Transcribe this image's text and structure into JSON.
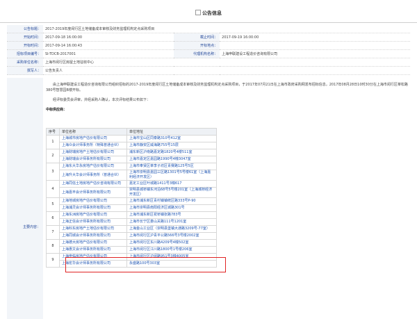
{
  "header": {
    "title": "公告信息"
  },
  "meta": {
    "rows": [
      {
        "k1": "公告标题：",
        "v1": "2017-2019年度闵行区土地储备成本审核及财务监理机构定点采购项目",
        "k2": "",
        "v2": ""
      },
      {
        "k1": "开始时间：",
        "v1": "2017-09-18 16:00:00",
        "k2": "截止时间：",
        "v2": "2017-09-19 16:00:00"
      },
      {
        "k1": "开标时间：",
        "v1": "2017-09-14 16:00:43",
        "k2": "开标地点：",
        "v2": ""
      },
      {
        "k1": "招标项目编号：",
        "v1": "SI-TDCB-2017001",
        "k2": "代理机构名称：",
        "v2": "上海申联建设工程造价咨询有限公司"
      },
      {
        "k1": "采购单位名称：",
        "v1": "上海市闵行区房屋土地征收中心",
        "k2": "",
        "v2": ""
      },
      {
        "k1": "撰写人：",
        "v1": "公告负责人",
        "k2": "",
        "v2": ""
      }
    ]
  },
  "main": {
    "label": "主要内容：",
    "para1": "由上海申联建设工程造价咨询有限公司组织招标的2017-2019年度闵行区土地储备成本审核及财务监理机构定点采购项目，于2017年07月21日在上海市政府采购网发布招标信息，2017年08月28日10时30分在上海市闵行区莘松路380号智慧园B楼开标。",
    "para2": "经评标委员会评审，并经采购人确认，本次评标结果公布如下：",
    "subtitle": "中标供应商：",
    "table": {
      "headers": [
        "序号",
        "单位名称",
        "单位地址"
      ],
      "rows": [
        {
          "n": "1",
          "unit": "上海城市房地产估价有限公司",
          "addr": "上海市宝山区同泰路310号412室"
        },
        {
          "n": "",
          "unit": "上海众会计师事务所（特殊普通合伙）",
          "addr": "上海市静安区威海路755号15层"
        },
        {
          "n": "2",
          "unit": "上海财瑞房地产土地估价有限公司",
          "addr": "浦东新区沪南路嘉定路1820号4楼511室"
        },
        {
          "n": "",
          "unit": "上海财瑞会计师事务所有限公司",
          "addr": "上海市嘉定区嘉园路1990号4幢3047室"
        },
        {
          "n": "3",
          "unit": "上海东大华永房地产估价有限公司",
          "addr": "上海市奉贤区莘李子坊区青赛路125号5区"
        },
        {
          "n": "",
          "unit": "上海升大华会计师事务所（普通合伙）",
          "addr": "上海市崇明县嘉园三区路1301号5号楼61室（上海嘉利经济开发区）"
        },
        {
          "n": "4",
          "unit": "上海同信土地房地产估价咨询有限公司",
          "addr": "嘉定工业区叶城路1411号3幢617"
        },
        {
          "n": "",
          "unit": "上海嘉丰会计师事务所有限公司",
          "addr": "崇明县城桥镇东河沿68号5号楼201室（上海城桥经济开发区）"
        },
        {
          "n": "5",
          "unit": "上海地城房地产估价有限公司",
          "addr": "上海市浦东新区青村镇镇统区路333号P-90"
        },
        {
          "n": "",
          "unit": "上海浦灵会计师事务所有限公司",
          "addr": "上海市崇明县南阳经济区城路301号"
        },
        {
          "n": "6",
          "unit": "上海东洲房地产估价有限公司",
          "addr": "上海市浦东新区祝桥镇张路783号"
        },
        {
          "n": "",
          "unit": "上海正信会计师事务所有限公司",
          "addr": "上海市长宁区娄山关路111号1201室"
        },
        {
          "n": "7",
          "unit": "上海科东房地产土地估价有限公司",
          "addr": "上海金山工业区（崇明县堡镇大通路3209号-77室）"
        },
        {
          "n": "",
          "unit": "上海同城会计师事务所有限公司",
          "addr": "上海市闵行区沪青平公路566号3号楼2002室"
        },
        {
          "n": "8",
          "unit": "上海德大房地产估价有限公司",
          "addr": "上海市闵行区东川路4209号4幢502室"
        },
        {
          "n": "",
          "unit": "上海惠文会计师事务所有限公司",
          "addr": "上海市闵行区江川路1800号1号楼206室"
        },
        {
          "n": "9",
          "unit": "上海申佑房地产估价有限公司",
          "addr": "上海市闵行区沪闵路951号3幢4005室"
        },
        {
          "n": "",
          "unit": "上海宏华会计师事务所有限公司",
          "addr": "永盛路100号303室"
        }
      ]
    }
  },
  "colors": {
    "label_blue": "#23489a",
    "link_blue": "#1e55b3",
    "highlight_red": "#e02222"
  }
}
